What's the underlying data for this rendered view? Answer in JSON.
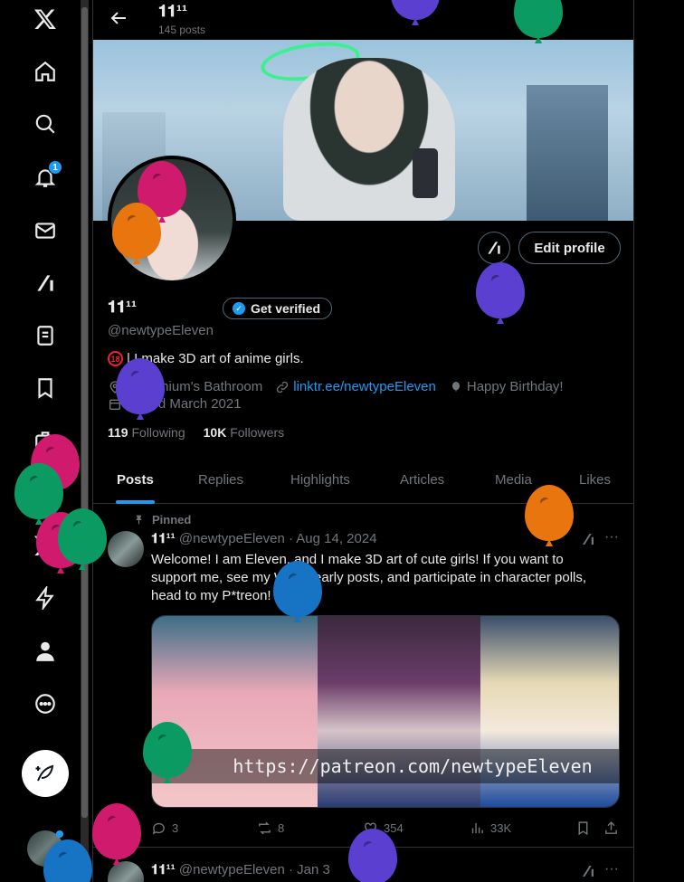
{
  "sidebar": {
    "items": [
      {
        "name": "x-logo-icon"
      },
      {
        "name": "home-icon"
      },
      {
        "name": "explore-icon"
      },
      {
        "name": "notifications-icon",
        "badge": "1"
      },
      {
        "name": "messages-icon"
      },
      {
        "name": "grok-icon"
      },
      {
        "name": "lists-icon"
      },
      {
        "name": "bookmarks-icon"
      },
      {
        "name": "jobs-icon"
      },
      {
        "name": "communities-icon"
      },
      {
        "name": "premium-icon"
      },
      {
        "name": "verified-orgs-icon"
      },
      {
        "name": "profile-icon"
      },
      {
        "name": "more-icon"
      }
    ],
    "compose": "post-compose-icon"
  },
  "header": {
    "name": "𝟏𝟏¹¹",
    "post_count": "145 posts"
  },
  "profile": {
    "display_name": "𝟏𝟏¹¹",
    "get_verified": "Get verified",
    "edit_profile": "Edit profile",
    "handle": "@newtypeEleven",
    "age_badge": "18",
    "bio": "| I make 3D art of anime girls.",
    "location": "Millennium's Bathroom",
    "link": "linktr.ee/newtypeEleven",
    "birthday": "Happy Birthday!",
    "joined": "Joined March 2021",
    "following_count": "119",
    "following_label": "Following",
    "followers_count": "10K",
    "followers_label": "Followers"
  },
  "tabs": [
    "Posts",
    "Replies",
    "Highlights",
    "Articles",
    "Media",
    "Likes"
  ],
  "posts": [
    {
      "pinned_label": "Pinned",
      "author": "𝟏𝟏¹¹",
      "meta": "@newtypeEleven · Aug 14, 2024",
      "text": "Welcome! I am Eleven, and I make 3D art of cute girls! If you want to support me, see my WIPs, early posts, and participate in character polls, head to my P*treon!",
      "media_caption": "https://patreon.com/newtypeEleven",
      "replies": "3",
      "reposts": "8",
      "likes": "354",
      "views": "33K"
    },
    {
      "author": "𝟏𝟏¹¹",
      "meta": "@newtypeEleven · Jan 3"
    }
  ],
  "colors": {
    "accent": "#1d9bf0",
    "background": "#000000",
    "text": "#e7e9ea",
    "muted": "#71767b"
  }
}
